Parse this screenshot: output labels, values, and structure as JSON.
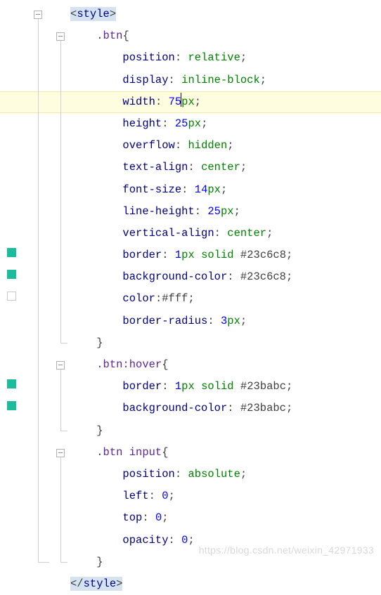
{
  "watermark": "https://blog.csdn.net/weixin_42971933",
  "code": {
    "tag_open_name": "style",
    "tag_close_name": "style",
    "lt": "<",
    "gt": ">",
    "lts": "</",
    "highlight_line_index": 4,
    "cursor_after_token_index_on_hl": 3,
    "indent1": "    ",
    "indent2": "        ",
    "selectors": {
      "btn": ".btn",
      "btn_hover": ".btn:hover",
      "btn_input": ".btn input"
    },
    "braces": {
      "open": "{",
      "close": "}"
    },
    "rules_btn": [
      {
        "prop": "position",
        "parts": [
          {
            "t": "ident",
            "v": "relative"
          }
        ]
      },
      {
        "prop": "display",
        "parts": [
          {
            "t": "ident",
            "v": "inline-block"
          }
        ]
      },
      {
        "prop": "width",
        "parts": [
          {
            "t": "num",
            "v": "75"
          },
          {
            "t": "unit",
            "v": "px"
          }
        ]
      },
      {
        "prop": "height",
        "parts": [
          {
            "t": "num",
            "v": "25"
          },
          {
            "t": "unit",
            "v": "px"
          }
        ]
      },
      {
        "prop": "overflow",
        "parts": [
          {
            "t": "ident",
            "v": "hidden"
          }
        ]
      },
      {
        "prop": "text-align",
        "parts": [
          {
            "t": "ident",
            "v": "center"
          }
        ]
      },
      {
        "prop": "font-size",
        "parts": [
          {
            "t": "num",
            "v": "14"
          },
          {
            "t": "unit",
            "v": "px"
          }
        ]
      },
      {
        "prop": "line-height",
        "parts": [
          {
            "t": "num",
            "v": "25"
          },
          {
            "t": "unit",
            "v": "px"
          }
        ]
      },
      {
        "prop": "vertical-align",
        "parts": [
          {
            "t": "ident",
            "v": "center"
          }
        ]
      },
      {
        "prop": "border",
        "parts": [
          {
            "t": "num",
            "v": "1"
          },
          {
            "t": "unit",
            "v": "px"
          },
          {
            "t": "sp",
            "v": " "
          },
          {
            "t": "ident",
            "v": "solid"
          },
          {
            "t": "sp",
            "v": " "
          },
          {
            "t": "hex",
            "v": "#23c6c8"
          }
        ]
      },
      {
        "prop": "background-color",
        "parts": [
          {
            "t": "hex",
            "v": "#23c6c8"
          }
        ]
      },
      {
        "prop": "color",
        "nospace": true,
        "parts": [
          {
            "t": "hex",
            "v": "#fff"
          }
        ]
      },
      {
        "prop": "border-radius",
        "parts": [
          {
            "t": "num",
            "v": "3"
          },
          {
            "t": "unit",
            "v": "px"
          }
        ]
      }
    ],
    "rules_btn_hover": [
      {
        "prop": "border",
        "parts": [
          {
            "t": "num",
            "v": "1"
          },
          {
            "t": "unit",
            "v": "px"
          },
          {
            "t": "sp",
            "v": " "
          },
          {
            "t": "ident",
            "v": "solid"
          },
          {
            "t": "sp",
            "v": " "
          },
          {
            "t": "hex",
            "v": "#23babc"
          }
        ]
      },
      {
        "prop": "background-color",
        "parts": [
          {
            "t": "hex",
            "v": "#23babc"
          }
        ]
      }
    ],
    "rules_btn_input": [
      {
        "prop": "position",
        "parts": [
          {
            "t": "ident",
            "v": "absolute"
          }
        ]
      },
      {
        "prop": "left",
        "parts": [
          {
            "t": "num",
            "v": "0"
          }
        ]
      },
      {
        "prop": "top",
        "parts": [
          {
            "t": "num",
            "v": "0"
          }
        ]
      },
      {
        "prop": "opacity",
        "parts": [
          {
            "t": "num",
            "v": "0"
          }
        ]
      }
    ],
    "gutter_marks": {
      "11": "filled",
      "12": "filled",
      "13": "hollow",
      "17": "filled",
      "18": "filled"
    },
    "fold_controls_outer": {
      "start": 0,
      "end": 25
    },
    "fold_controls_inner": [
      {
        "start": 1,
        "end": 15
      },
      {
        "start": 16,
        "end": 19
      },
      {
        "start": 20,
        "end": 25
      }
    ]
  }
}
